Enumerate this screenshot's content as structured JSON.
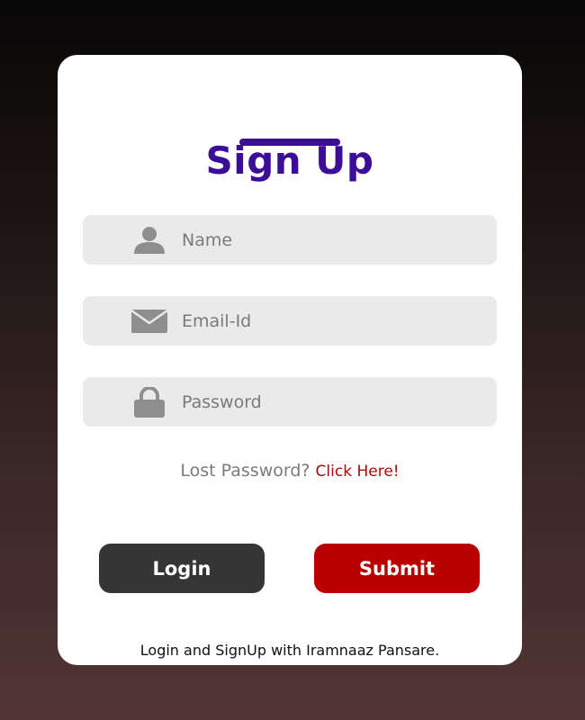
{
  "form": {
    "title": "Sign Up",
    "fields": {
      "name": {
        "placeholder": "Name",
        "value": "",
        "icon": "user-icon"
      },
      "email": {
        "placeholder": "Email-Id",
        "value": "",
        "icon": "envelope-icon"
      },
      "password": {
        "placeholder": "Password",
        "value": "",
        "icon": "lock-icon"
      }
    },
    "lost_password_text": "Lost Password?",
    "lost_password_link": "Click Here!",
    "login_label": "Login",
    "submit_label": "Submit",
    "footer_text": "Login and SignUp with Iramnaaz Pansare."
  },
  "colors": {
    "title": "#3c0d99",
    "link": "#a10d0d",
    "login_button": "#353535",
    "submit_button": "#b80000",
    "field_bg": "#eaeaea",
    "icon": "#8e8e8e"
  }
}
